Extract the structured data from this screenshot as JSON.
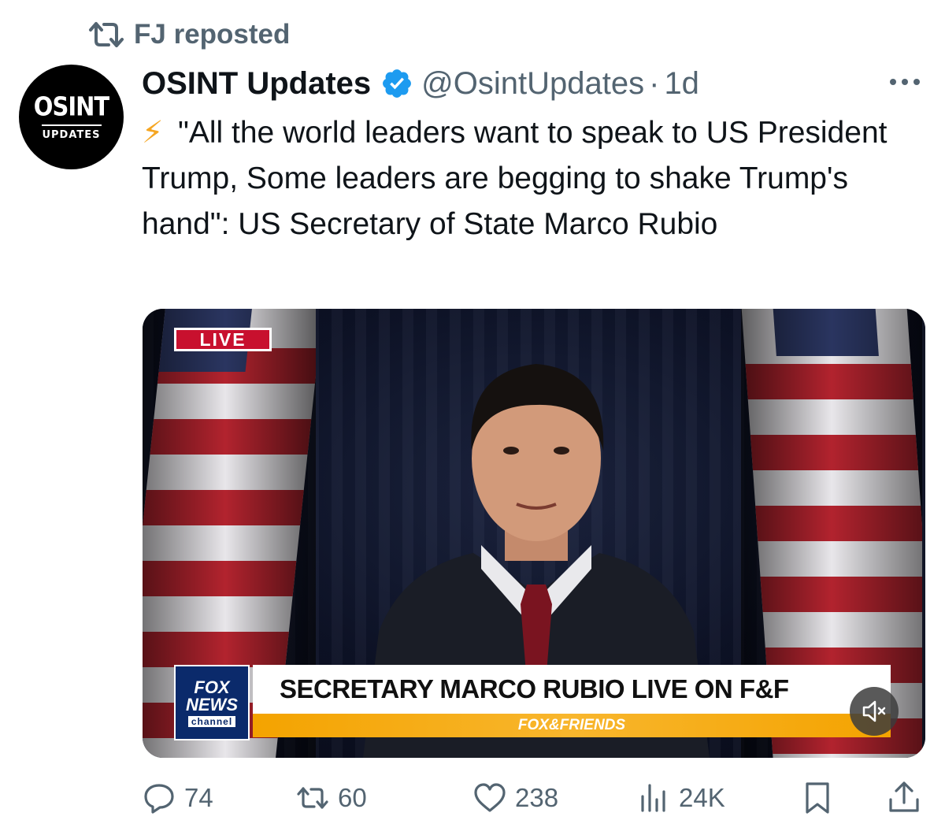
{
  "repost": {
    "label": "FJ reposted"
  },
  "author": {
    "avatar_title": "OSINT",
    "avatar_subtitle": "UPDATES",
    "name": "OSINT Updates",
    "handle": "@OsintUpdates",
    "separator": "·",
    "time": "1d"
  },
  "tweet": {
    "emoji": "⚡",
    "text": "\"All the world leaders want to speak to US President Trump, Some leaders are begging to shake Trump's hand\": US Secretary of State Marco Rubio"
  },
  "media": {
    "live_label": "LIVE",
    "network_line1": "FOX",
    "network_line2": "NEWS",
    "network_line3": "channel",
    "headline": "SECRETARY MARCO RUBIO LIVE ON F&F",
    "show_name": "FOX&FRIENDS"
  },
  "actions": {
    "replies": "74",
    "reposts": "60",
    "likes": "238",
    "views": "24K"
  },
  "colors": {
    "text_primary": "#0f1419",
    "text_secondary": "#536471",
    "verified": "#1d9bf0",
    "live_red": "#c8102e",
    "fox_blue": "#0b2a6b",
    "show_orange": "#f4a300"
  },
  "icons": [
    "repost-icon",
    "verified-icon",
    "more-icon",
    "lightning-icon",
    "mute-icon",
    "reply-icon",
    "retweet-icon",
    "like-icon",
    "views-icon",
    "bookmark-icon",
    "share-icon"
  ]
}
